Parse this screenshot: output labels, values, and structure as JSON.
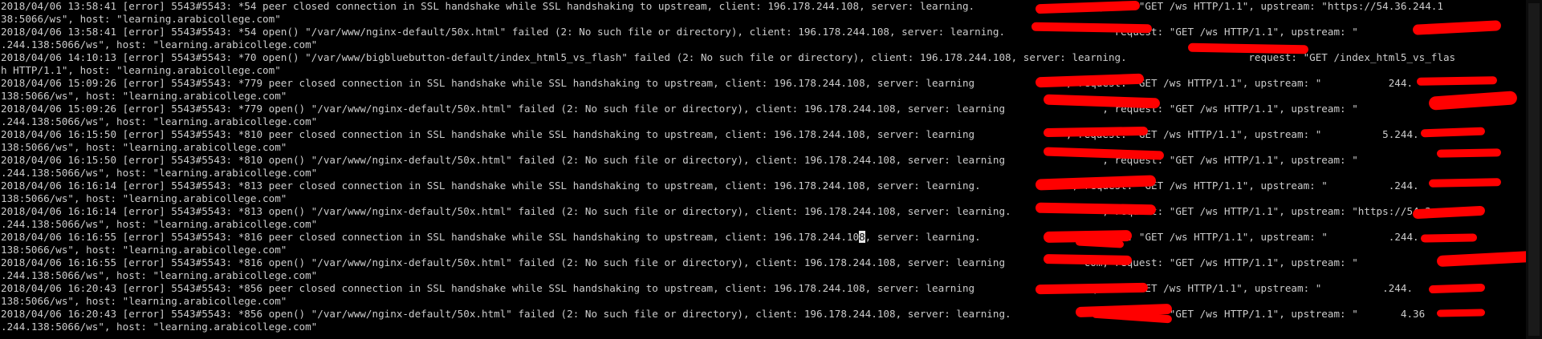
{
  "terminal": {
    "colors": {
      "background": "#000000",
      "text": "#cccccc",
      "redaction": "#ff0000"
    },
    "cursor": {
      "line_index": 18,
      "char_after": "8"
    },
    "lines": [
      "2018/04/06 13:58:41 [error] 5543#5543: *54 peer closed connection in SSL handshake while SSL handshaking to upstream, client: 196.178.244.108, server: learning.                , request: \"GET /ws HTTP/1.1\", upstream: \"https://54.36.244.1",
      "38:5066/ws\", host: \"learning.arabicollege.com\"",
      "2018/04/06 13:58:41 [error] 5543#5543: *54 open() \"/var/www/nginx-default/50x.html\" failed (2: No such file or directory), client: 196.178.244.108, server: learning.                  request: \"GET /ws HTTP/1.1\", upstream: \"",
      ".244.138:5066/ws\", host: \"learning.arabicollege.com\"",
      "2018/04/06 14:10:13 [error] 5543#5543: *70 open() \"/var/www/bigbluebutton-default/index_html5_vs_flash\" failed (2: No such file or directory), client: 196.178.244.108, server: learning.                    request: \"GET /index_html5_vs_flas",
      "h HTTP/1.1\", host: \"learning.arabicollege.com\"",
      "2018/04/06 15:09:26 [error] 5543#5543: *779 peer closed connection in SSL handshake while SSL handshaking to upstream, client: 196.178.244.108, server: learning               , request: \"GET /ws HTTP/1.1\", upstream: \"           244.",
      "138:5066/ws\", host: \"learning.arabicollege.com\"",
      "2018/04/06 15:09:26 [error] 5543#5543: *779 open() \"/var/www/nginx-default/50x.html\" failed (2: No such file or directory), client: 196.178.244.108, server: learning                , request: \"GET /ws HTTP/1.1\", upstream: \"",
      ".244.138:5066/ws\", host: \"learning.arabicollege.com\"",
      "2018/04/06 16:15:50 [error] 5543#5543: *810 peer closed connection in SSL handshake while SSL handshaking to upstream, client: 196.178.244.108, server: learning               , request: \"GET /ws HTTP/1.1\", upstream: \"          5.244.",
      "138:5066/ws\", host: \"learning.arabicollege.com\"",
      "2018/04/06 16:15:50 [error] 5543#5543: *810 open() \"/var/www/nginx-default/50x.html\" failed (2: No such file or directory), client: 196.178.244.108, server: learning                , request: \"GET /ws HTTP/1.1\", upstream: \"",
      ".244.138:5066/ws\", host: \"learning.arabicollege.com\"",
      "2018/04/06 16:16:14 [error] 5543#5543: *813 peer closed connection in SSL handshake while SSL handshaking to upstream, client: 196.178.244.108, server: learning.               , request: \"GET /ws HTTP/1.1\", upstream: \"          .244.",
      "138:5066/ws\", host: \"learning.arabicollege.com\"",
      "2018/04/06 16:16:14 [error] 5543#5543: *813 open() \"/var/www/nginx-default/50x.html\" failed (2: No such file or directory), client: 196.178.244.108, server: learning.               , request: \"GET /ws HTTP/1.1\", upstream: \"https://54.3",
      ".244.138:5066/ws\", host: \"learning.arabicollege.com\"",
      "2018/04/06 16:16:55 [error] 5543#5543: *816 peer closed connection in SSL handshake while SSL handshaking to upstream, client: 196.178.244.108, server: learning.               , request: \"GET /ws HTTP/1.1\", upstream: \"          .244.",
      "138:5066/ws\", host: \"learning.arabicollege.com\"",
      "2018/04/06 16:16:55 [error] 5543#5543: *816 open() \"/var/www/nginx-default/50x.html\" failed (2: No such file or directory), client: 196.178.244.108, server: learning             com, request: \"GET /ws HTTP/1.1\", upstream: \"",
      ".244.138:5066/ws\", host: \"learning.arabicollege.com\"",
      "2018/04/06 16:20:43 [error] 5543#5543: *856 peer closed connection in SSL handshake while SSL handshaking to upstream, client: 196.178.244.108, server: learning               , request: \"GET /ws HTTP/1.1\", upstream: \"          .244.",
      "138:5066/ws\", host: \"learning.arabicollege.com\"",
      "2018/04/06 16:20:43 [error] 5543#5543: *856 open() \"/var/www/nginx-default/50x.html\" failed (2: No such file or directory), client: 196.178.244.108, server: learning.               , request: \"GET /ws HTTP/1.1\", upstream: \"       4.36",
      ".244.138:5066/ws\", host: \"learning.arabicollege.com\""
    ]
  }
}
